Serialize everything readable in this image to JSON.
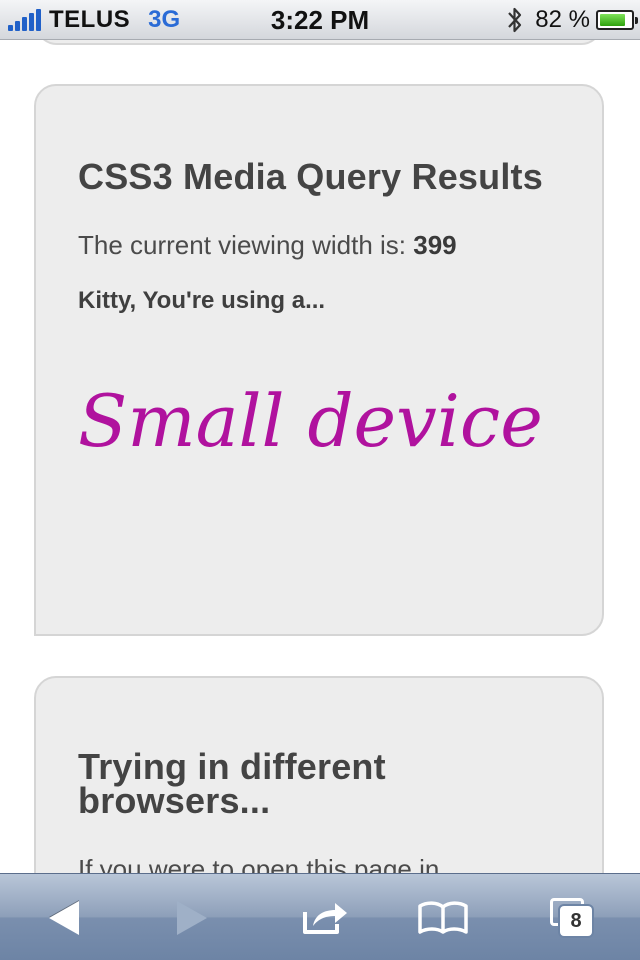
{
  "status_bar": {
    "carrier": "TELUS",
    "network": "3G",
    "time": "3:22 PM",
    "battery_percent": "82 %",
    "battery_level": 0.82,
    "signal_icon": "signal-bars-icon",
    "bluetooth_icon": "bluetooth-icon",
    "battery_icon": "battery-icon"
  },
  "cards": {
    "results": {
      "title": "CSS3 Media Query Results",
      "width_label": "The current viewing width is:",
      "width_value": "399",
      "kitty_text": "Kitty, You're using a...",
      "device_text": "Small device",
      "device_color": "#b0129e"
    },
    "browsers": {
      "title": "Trying in different browsers...",
      "body_text": "If you were to open this page in"
    }
  },
  "toolbar": {
    "back_icon": "back-arrow-icon",
    "forward_icon": "forward-arrow-icon",
    "share_icon": "share-icon",
    "bookmarks_icon": "bookmarks-icon",
    "pages_icon": "pages-icon",
    "pages_count": "8"
  }
}
